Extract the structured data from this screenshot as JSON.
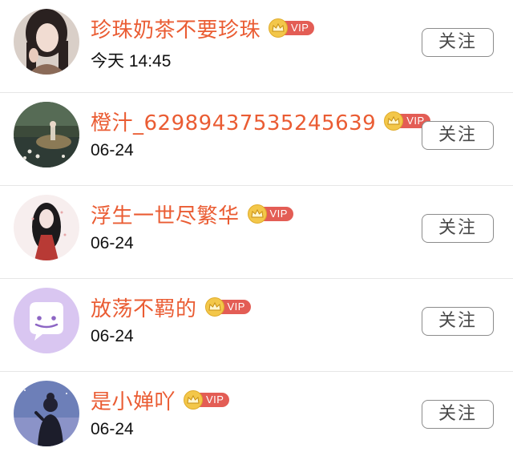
{
  "users": [
    {
      "name": "珍珠奶茶不要珍珠",
      "time": "今天 14:45",
      "vip_label": "VIP",
      "follow_label": "关注"
    },
    {
      "name": "橙汁_62989437535245639",
      "time": "06-24",
      "vip_label": "VIP",
      "follow_label": "关注"
    },
    {
      "name": "浮生一世尽繁华",
      "time": "06-24",
      "vip_label": "VIP",
      "follow_label": "关注"
    },
    {
      "name": "放荡不羁的",
      "time": "06-24",
      "vip_label": "VIP",
      "follow_label": "关注"
    },
    {
      "name": "是小婵吖",
      "time": "06-24",
      "vip_label": "VIP",
      "follow_label": "关注"
    }
  ],
  "colors": {
    "username": "#ea5c33",
    "vip_badge": "#e35d55",
    "crown": "#f3c74a",
    "button_border": "#8c8c8c"
  },
  "icons": {
    "vip": "crown-icon"
  }
}
